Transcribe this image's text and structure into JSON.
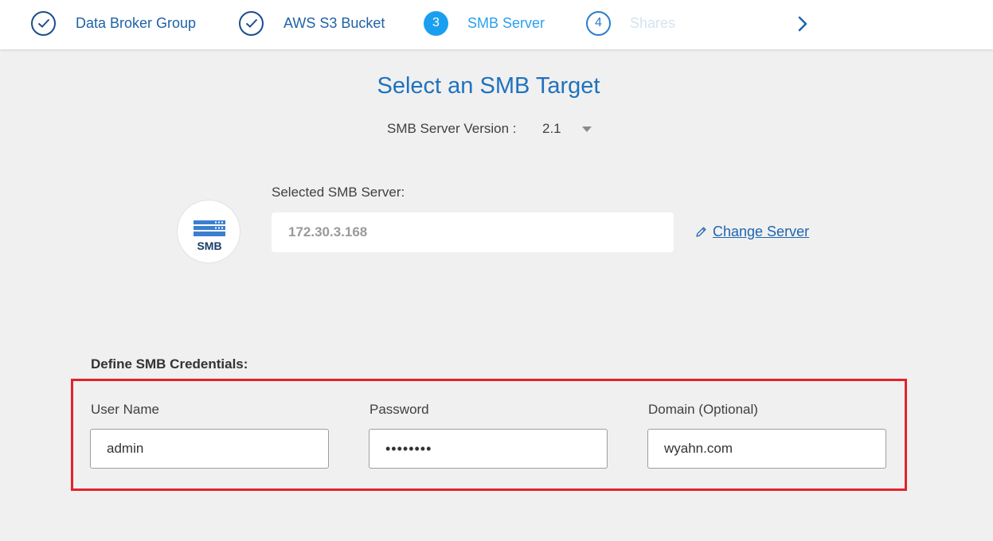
{
  "wizard": {
    "steps": [
      {
        "label": "Data Broker Group",
        "state": "done",
        "icon": "check-icon"
      },
      {
        "label": "AWS S3 Bucket",
        "state": "done",
        "icon": "check-icon"
      },
      {
        "number": "3",
        "label": "SMB Server",
        "state": "active"
      },
      {
        "number": "4",
        "label": "Shares",
        "state": "pending"
      }
    ],
    "next_icon": "chevron-right-icon"
  },
  "main": {
    "title": "Select an SMB Target",
    "version_label": "SMB Server Version :",
    "version_value": "2.1",
    "server_icon_text": "SMB",
    "selected_server_label": "Selected SMB Server:",
    "selected_server_value": "172.30.3.168",
    "change_server_label": "Change Server"
  },
  "credentials": {
    "heading": "Define SMB Credentials:",
    "username_label": "User Name",
    "username_value": "admin",
    "password_label": "Password",
    "password_value": "••••••••",
    "domain_label": "Domain (Optional)",
    "domain_value": "wyahn.com"
  },
  "colors": {
    "primary": "#1f72bd",
    "active_step": "#1a9ff0",
    "highlight": "#e3222b"
  }
}
